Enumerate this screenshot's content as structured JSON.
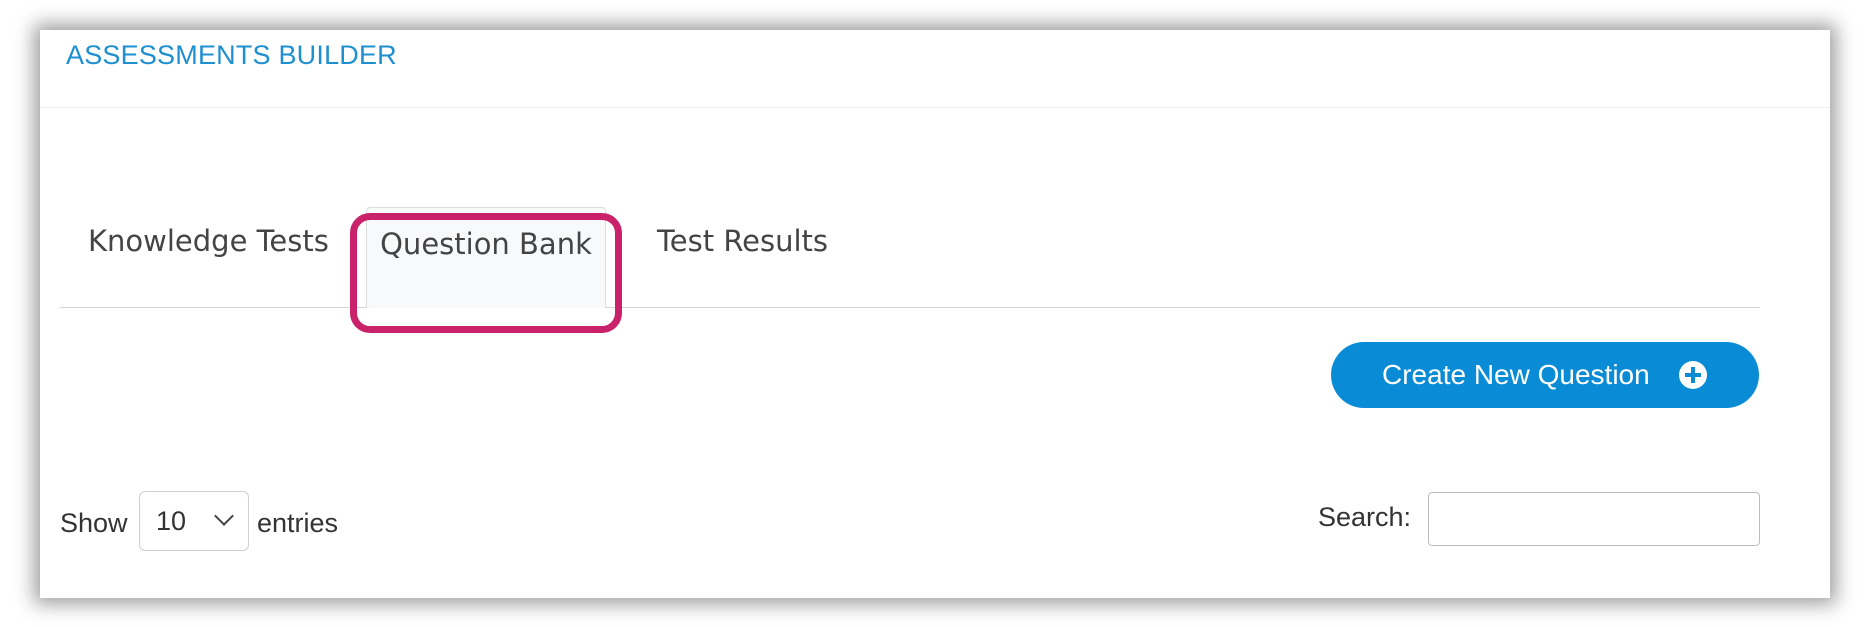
{
  "header": {
    "title": "ASSESSMENTS BUILDER"
  },
  "tabs": [
    {
      "label": "Knowledge Tests"
    },
    {
      "label": "Question Bank",
      "active": true
    },
    {
      "label": "Test Results"
    }
  ],
  "actions": {
    "create_label": "Create New Question",
    "create_icon": "plus-circle-icon"
  },
  "table_controls": {
    "show_label": "Show",
    "page_length": "10",
    "entries_label": "entries",
    "search_label": "Search:",
    "search_value": ""
  },
  "colors": {
    "accent": "#0a8bd6",
    "title": "#1e8fd0",
    "highlight": "#c9226b"
  }
}
